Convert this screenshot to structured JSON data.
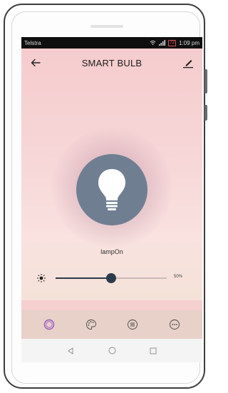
{
  "status_bar": {
    "carrier": "Telstra",
    "battery": "72",
    "time": "1:09 pm"
  },
  "app_bar": {
    "title": "SMART BULB"
  },
  "device": {
    "name": "lampOn"
  },
  "brightness": {
    "level": 0.5,
    "label": "50%"
  },
  "bottom_nav": {
    "items": [
      "power-icon",
      "palette-icon",
      "list-icon",
      "more-icon"
    ],
    "active": "power-icon"
  },
  "colors": {
    "background": "#f6cfd0",
    "bulb_circle": "#6f7f91",
    "slider": "#2c3a4b",
    "active_nav": "#9b57c0"
  }
}
